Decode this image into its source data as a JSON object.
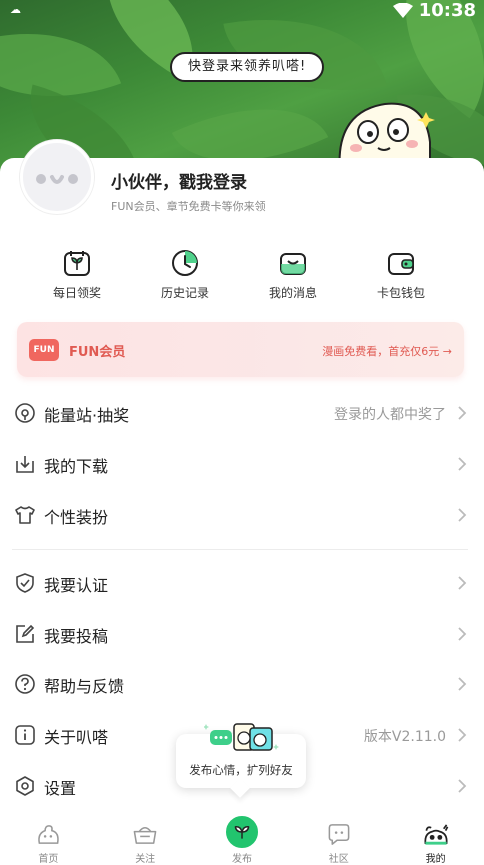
{
  "status_bar": {
    "time": "10:38"
  },
  "banner": {
    "bubble_text": "快登录来领养叭嗒!"
  },
  "profile": {
    "name": "小伙伴，戳我登录",
    "subtitle": "FUN会员、章节免费卡等你来领"
  },
  "quick_actions": [
    {
      "label": "每日领奖",
      "icon": "daily-reward-icon"
    },
    {
      "label": "历史记录",
      "icon": "history-icon"
    },
    {
      "label": "我的消息",
      "icon": "message-icon"
    },
    {
      "label": "卡包钱包",
      "icon": "wallet-icon"
    }
  ],
  "vip": {
    "badge": "FUN",
    "title": "FUN会员",
    "promo": "漫画免费看，首充仅6元 →"
  },
  "menu": [
    {
      "label": "能量站·抽奖",
      "extra": "登录的人都中奖了",
      "icon": "lottery-icon"
    },
    {
      "label": "我的下载",
      "extra": "",
      "icon": "download-icon"
    },
    {
      "label": "个性装扮",
      "extra": "",
      "icon": "tshirt-icon"
    },
    {
      "label": "我要认证",
      "extra": "",
      "icon": "shield-check-icon"
    },
    {
      "label": "我要投稿",
      "extra": "",
      "icon": "edit-icon"
    },
    {
      "label": "帮助与反馈",
      "extra": "",
      "icon": "help-icon"
    },
    {
      "label": "关于叭嗒",
      "extra": "版本V2.11.0",
      "icon": "info-icon"
    },
    {
      "label": "设置",
      "extra": "",
      "icon": "settings-icon"
    }
  ],
  "publish_tip": {
    "text": "发布心情，扩列好友"
  },
  "tabs": [
    {
      "label": "首页",
      "icon": "home-icon"
    },
    {
      "label": "关注",
      "icon": "follow-icon"
    },
    {
      "label": "发布",
      "icon": "publish-icon"
    },
    {
      "label": "社区",
      "icon": "community-icon"
    },
    {
      "label": "我的",
      "icon": "profile-icon"
    }
  ],
  "colors": {
    "accent_green": "#22c46e",
    "vip_red": "#e05a52",
    "banner_green": "#3d8a37"
  }
}
